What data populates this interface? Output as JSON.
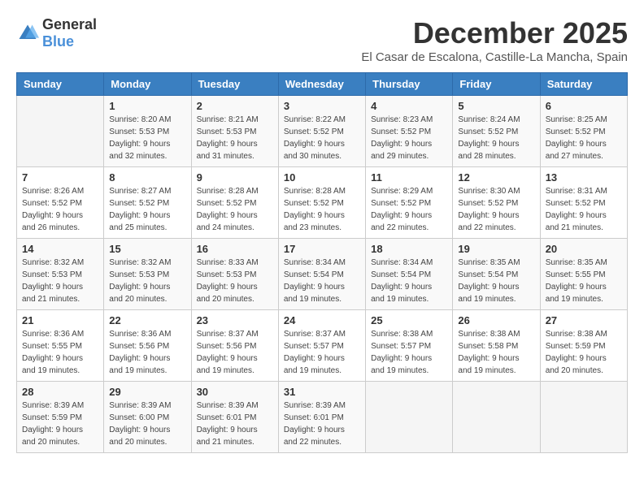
{
  "logo": {
    "general": "General",
    "blue": "Blue"
  },
  "title": "December 2025",
  "subtitle": "El Casar de Escalona, Castille-La Mancha, Spain",
  "days_of_week": [
    "Sunday",
    "Monday",
    "Tuesday",
    "Wednesday",
    "Thursday",
    "Friday",
    "Saturday"
  ],
  "weeks": [
    [
      {
        "day": "",
        "sunrise": "",
        "sunset": "",
        "daylight": ""
      },
      {
        "day": "1",
        "sunrise": "Sunrise: 8:20 AM",
        "sunset": "Sunset: 5:53 PM",
        "daylight": "Daylight: 9 hours and 32 minutes."
      },
      {
        "day": "2",
        "sunrise": "Sunrise: 8:21 AM",
        "sunset": "Sunset: 5:53 PM",
        "daylight": "Daylight: 9 hours and 31 minutes."
      },
      {
        "day": "3",
        "sunrise": "Sunrise: 8:22 AM",
        "sunset": "Sunset: 5:52 PM",
        "daylight": "Daylight: 9 hours and 30 minutes."
      },
      {
        "day": "4",
        "sunrise": "Sunrise: 8:23 AM",
        "sunset": "Sunset: 5:52 PM",
        "daylight": "Daylight: 9 hours and 29 minutes."
      },
      {
        "day": "5",
        "sunrise": "Sunrise: 8:24 AM",
        "sunset": "Sunset: 5:52 PM",
        "daylight": "Daylight: 9 hours and 28 minutes."
      },
      {
        "day": "6",
        "sunrise": "Sunrise: 8:25 AM",
        "sunset": "Sunset: 5:52 PM",
        "daylight": "Daylight: 9 hours and 27 minutes."
      }
    ],
    [
      {
        "day": "7",
        "sunrise": "Sunrise: 8:26 AM",
        "sunset": "Sunset: 5:52 PM",
        "daylight": "Daylight: 9 hours and 26 minutes."
      },
      {
        "day": "8",
        "sunrise": "Sunrise: 8:27 AM",
        "sunset": "Sunset: 5:52 PM",
        "daylight": "Daylight: 9 hours and 25 minutes."
      },
      {
        "day": "9",
        "sunrise": "Sunrise: 8:28 AM",
        "sunset": "Sunset: 5:52 PM",
        "daylight": "Daylight: 9 hours and 24 minutes."
      },
      {
        "day": "10",
        "sunrise": "Sunrise: 8:28 AM",
        "sunset": "Sunset: 5:52 PM",
        "daylight": "Daylight: 9 hours and 23 minutes."
      },
      {
        "day": "11",
        "sunrise": "Sunrise: 8:29 AM",
        "sunset": "Sunset: 5:52 PM",
        "daylight": "Daylight: 9 hours and 22 minutes."
      },
      {
        "day": "12",
        "sunrise": "Sunrise: 8:30 AM",
        "sunset": "Sunset: 5:52 PM",
        "daylight": "Daylight: 9 hours and 22 minutes."
      },
      {
        "day": "13",
        "sunrise": "Sunrise: 8:31 AM",
        "sunset": "Sunset: 5:52 PM",
        "daylight": "Daylight: 9 hours and 21 minutes."
      }
    ],
    [
      {
        "day": "14",
        "sunrise": "Sunrise: 8:32 AM",
        "sunset": "Sunset: 5:53 PM",
        "daylight": "Daylight: 9 hours and 21 minutes."
      },
      {
        "day": "15",
        "sunrise": "Sunrise: 8:32 AM",
        "sunset": "Sunset: 5:53 PM",
        "daylight": "Daylight: 9 hours and 20 minutes."
      },
      {
        "day": "16",
        "sunrise": "Sunrise: 8:33 AM",
        "sunset": "Sunset: 5:53 PM",
        "daylight": "Daylight: 9 hours and 20 minutes."
      },
      {
        "day": "17",
        "sunrise": "Sunrise: 8:34 AM",
        "sunset": "Sunset: 5:54 PM",
        "daylight": "Daylight: 9 hours and 19 minutes."
      },
      {
        "day": "18",
        "sunrise": "Sunrise: 8:34 AM",
        "sunset": "Sunset: 5:54 PM",
        "daylight": "Daylight: 9 hours and 19 minutes."
      },
      {
        "day": "19",
        "sunrise": "Sunrise: 8:35 AM",
        "sunset": "Sunset: 5:54 PM",
        "daylight": "Daylight: 9 hours and 19 minutes."
      },
      {
        "day": "20",
        "sunrise": "Sunrise: 8:35 AM",
        "sunset": "Sunset: 5:55 PM",
        "daylight": "Daylight: 9 hours and 19 minutes."
      }
    ],
    [
      {
        "day": "21",
        "sunrise": "Sunrise: 8:36 AM",
        "sunset": "Sunset: 5:55 PM",
        "daylight": "Daylight: 9 hours and 19 minutes."
      },
      {
        "day": "22",
        "sunrise": "Sunrise: 8:36 AM",
        "sunset": "Sunset: 5:56 PM",
        "daylight": "Daylight: 9 hours and 19 minutes."
      },
      {
        "day": "23",
        "sunrise": "Sunrise: 8:37 AM",
        "sunset": "Sunset: 5:56 PM",
        "daylight": "Daylight: 9 hours and 19 minutes."
      },
      {
        "day": "24",
        "sunrise": "Sunrise: 8:37 AM",
        "sunset": "Sunset: 5:57 PM",
        "daylight": "Daylight: 9 hours and 19 minutes."
      },
      {
        "day": "25",
        "sunrise": "Sunrise: 8:38 AM",
        "sunset": "Sunset: 5:57 PM",
        "daylight": "Daylight: 9 hours and 19 minutes."
      },
      {
        "day": "26",
        "sunrise": "Sunrise: 8:38 AM",
        "sunset": "Sunset: 5:58 PM",
        "daylight": "Daylight: 9 hours and 19 minutes."
      },
      {
        "day": "27",
        "sunrise": "Sunrise: 8:38 AM",
        "sunset": "Sunset: 5:59 PM",
        "daylight": "Daylight: 9 hours and 20 minutes."
      }
    ],
    [
      {
        "day": "28",
        "sunrise": "Sunrise: 8:39 AM",
        "sunset": "Sunset: 5:59 PM",
        "daylight": "Daylight: 9 hours and 20 minutes."
      },
      {
        "day": "29",
        "sunrise": "Sunrise: 8:39 AM",
        "sunset": "Sunset: 6:00 PM",
        "daylight": "Daylight: 9 hours and 20 minutes."
      },
      {
        "day": "30",
        "sunrise": "Sunrise: 8:39 AM",
        "sunset": "Sunset: 6:01 PM",
        "daylight": "Daylight: 9 hours and 21 minutes."
      },
      {
        "day": "31",
        "sunrise": "Sunrise: 8:39 AM",
        "sunset": "Sunset: 6:01 PM",
        "daylight": "Daylight: 9 hours and 22 minutes."
      },
      {
        "day": "",
        "sunrise": "",
        "sunset": "",
        "daylight": ""
      },
      {
        "day": "",
        "sunrise": "",
        "sunset": "",
        "daylight": ""
      },
      {
        "day": "",
        "sunrise": "",
        "sunset": "",
        "daylight": ""
      }
    ]
  ]
}
